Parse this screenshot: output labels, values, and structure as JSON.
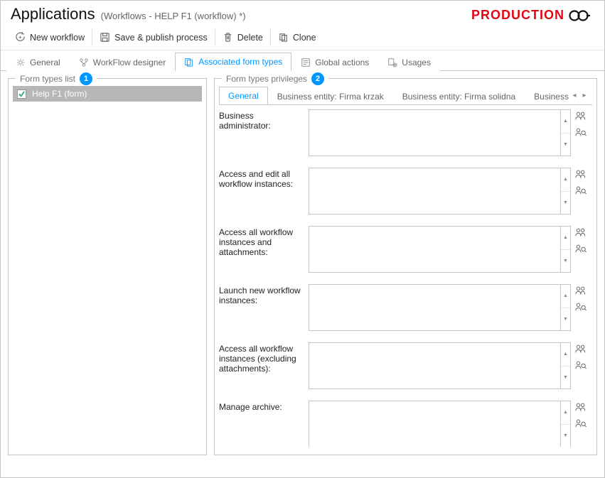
{
  "header": {
    "title": "Applications",
    "subtitle": "(Workflows - HELP F1 (workflow) *)",
    "brand": "PRODUCTION"
  },
  "toolbar": {
    "new_workflow": "New workflow",
    "save_publish": "Save & publish process",
    "delete": "Delete",
    "clone": "Clone"
  },
  "tabs": {
    "general": "General",
    "workflow_designer": "WorkFlow designer",
    "associated_form_types": "Associated form types",
    "global_actions": "Global actions",
    "usages": "Usages"
  },
  "left": {
    "legend": "Form types list",
    "badge": "1",
    "items": [
      {
        "label": "Help F1 (form)",
        "checked": true
      }
    ]
  },
  "right": {
    "legend": "Form types privileges",
    "badge": "2",
    "tabs": [
      "General",
      "Business entity: Firma krzak",
      "Business entity: Firma solidna",
      "Business entity: WEB"
    ],
    "rows": [
      {
        "label": "Business administrator:"
      },
      {
        "label": "Access and edit all workflow instances:"
      },
      {
        "label": "Access all workflow instances and attachments:"
      },
      {
        "label": "Launch new workflow instances:"
      },
      {
        "label": "Access all workflow instances (excluding attachments):"
      },
      {
        "label": "Manage archive:"
      }
    ]
  }
}
